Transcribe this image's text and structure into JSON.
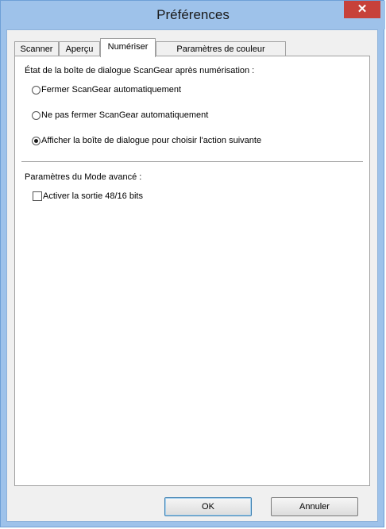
{
  "window": {
    "title": "Préférences",
    "close_glyph": "✕"
  },
  "tabs": [
    {
      "label": "Scanner",
      "active": false
    },
    {
      "label": "Aperçu",
      "active": false
    },
    {
      "label": "Numériser",
      "active": true
    },
    {
      "label": "Paramètres de couleur",
      "active": false
    }
  ],
  "scan_tab": {
    "after_scan_heading": "État de la boîte de dialogue ScanGear après numérisation :",
    "options": [
      {
        "label": "Fermer ScanGear automatiquement",
        "selected": false
      },
      {
        "label": "Ne pas fermer ScanGear automatiquement",
        "selected": false
      },
      {
        "label": "Afficher la boîte de dialogue pour choisir l'action suivante",
        "selected": true
      }
    ],
    "advanced_heading": "Paramètres du Mode avancé :",
    "enable_48_16_label": "Activer la sortie 48/16 bits",
    "enable_48_16_checked": false
  },
  "buttons": {
    "ok_label": "OK",
    "cancel_label": "Annuler"
  },
  "colors": {
    "title_bar": "#9ec2ea",
    "close_button": "#c7413a"
  }
}
